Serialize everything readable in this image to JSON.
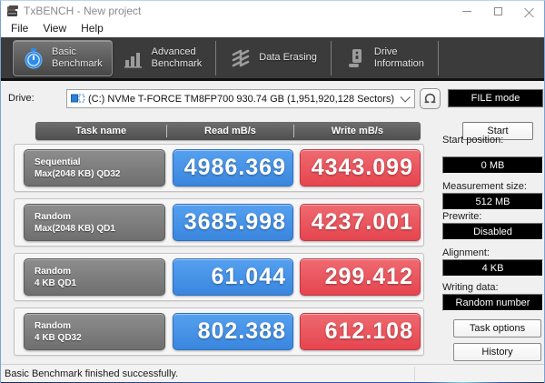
{
  "window": {
    "title": "TxBENCH - New project"
  },
  "menu": {
    "items": [
      "File",
      "View",
      "Help"
    ]
  },
  "toolbar": {
    "tabs": [
      {
        "line1": "Basic",
        "line2": "Benchmark",
        "icon": "stopwatch-icon",
        "selected": true
      },
      {
        "line1": "Advanced",
        "line2": "Benchmark",
        "icon": "bar-chart-icon",
        "selected": false
      },
      {
        "line1": "Data Erasing",
        "line2": "",
        "icon": "eraser-icon",
        "selected": false
      },
      {
        "line1": "Drive",
        "line2": "Information",
        "icon": "drive-tower-icon",
        "selected": false
      }
    ]
  },
  "drive": {
    "label": "Drive:",
    "value": "(C:) NVMe T-FORCE TM8FP700  930.74 GB (1,951,920,128 Sectors)",
    "mode_button": "FILE mode"
  },
  "table": {
    "headers": [
      "Task name",
      "Read mB/s",
      "Write mB/s"
    ],
    "rows": [
      {
        "task_line1": "Sequential",
        "task_line2": "Max(2048 KB) QD32",
        "read": "4986.369",
        "write": "4343.099"
      },
      {
        "task_line1": "Random",
        "task_line2": "Max(2048 KB) QD1",
        "read": "3685.998",
        "write": "4237.001"
      },
      {
        "task_line1": "Random",
        "task_line2": "4 KB QD1",
        "read": "61.044",
        "write": "299.412"
      },
      {
        "task_line1": "Random",
        "task_line2": "4 KB QD32",
        "read": "802.388",
        "write": "612.108"
      }
    ]
  },
  "sidebar": {
    "start_button": "Start",
    "fields": [
      {
        "label": "Start position:",
        "value": "0 MB"
      },
      {
        "label": "Measurement size:",
        "value": "512 MB"
      },
      {
        "label": "Prewrite:",
        "value": "Disabled"
      },
      {
        "label": "Alignment:",
        "value": "4 KB"
      },
      {
        "label": "Writing data:",
        "value": "Random number"
      }
    ],
    "buttons": [
      "Task options",
      "History"
    ]
  },
  "status": {
    "text": "Basic Benchmark finished successfully."
  },
  "colors": {
    "read_blue": "#3f8ce6",
    "write_red": "#e84c55",
    "task_gray": "#7e7e7e",
    "toolbar_dark": "#3b3b3b",
    "stopwatch_blue": "#2f8be8"
  }
}
